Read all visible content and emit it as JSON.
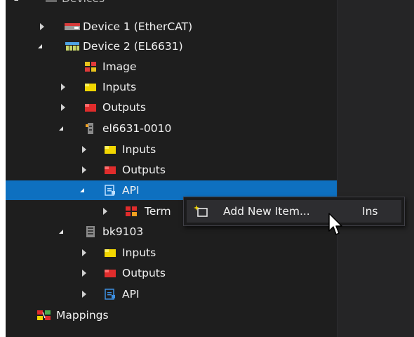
{
  "tree": {
    "top_partial_label": "Devices",
    "items": [
      {
        "label": "Device 1 (EtherCAT)",
        "icon": "ethercat-device-icon",
        "state": "collapsed",
        "depth": 1
      },
      {
        "label": "Device 2 (EL6631)",
        "icon": "network-device-icon",
        "state": "expanded",
        "depth": 1
      },
      {
        "label": "Image",
        "icon": "image-icon",
        "state": "none",
        "depth": 2
      },
      {
        "label": "Inputs",
        "icon": "inputs-icon",
        "state": "collapsed",
        "depth": 2
      },
      {
        "label": "Outputs",
        "icon": "outputs-icon",
        "state": "collapsed",
        "depth": 2
      },
      {
        "label": "el6631-0010",
        "icon": "terminal-icon",
        "state": "expanded",
        "depth": 2
      },
      {
        "label": "Inputs",
        "icon": "inputs-icon",
        "state": "collapsed",
        "depth": 3
      },
      {
        "label": "Outputs",
        "icon": "outputs-icon",
        "state": "collapsed",
        "depth": 3
      },
      {
        "label": "API",
        "icon": "api-icon",
        "state": "expanded",
        "depth": 3,
        "selected": true
      },
      {
        "label": "Term",
        "icon": "term-icon",
        "state": "collapsed",
        "depth": 4
      },
      {
        "label": "bk9103",
        "icon": "bus-coupler-icon",
        "state": "expanded",
        "depth": 2
      },
      {
        "label": "Inputs",
        "icon": "inputs-icon",
        "state": "collapsed",
        "depth": 3
      },
      {
        "label": "Outputs",
        "icon": "outputs-icon",
        "state": "collapsed",
        "depth": 3
      },
      {
        "label": "API",
        "icon": "api-icon",
        "state": "collapsed",
        "depth": 3
      },
      {
        "label": "Mappings",
        "icon": "mappings-icon",
        "state": "none",
        "depth": 1
      }
    ]
  },
  "context_menu": {
    "items": [
      {
        "label": "Add New Item...",
        "shortcut": "Ins",
        "icon": "add-new-item-icon"
      }
    ]
  },
  "colors": {
    "background": "#1e1e1e",
    "selection": "#0e70c0",
    "text": "#f1f1f1"
  }
}
